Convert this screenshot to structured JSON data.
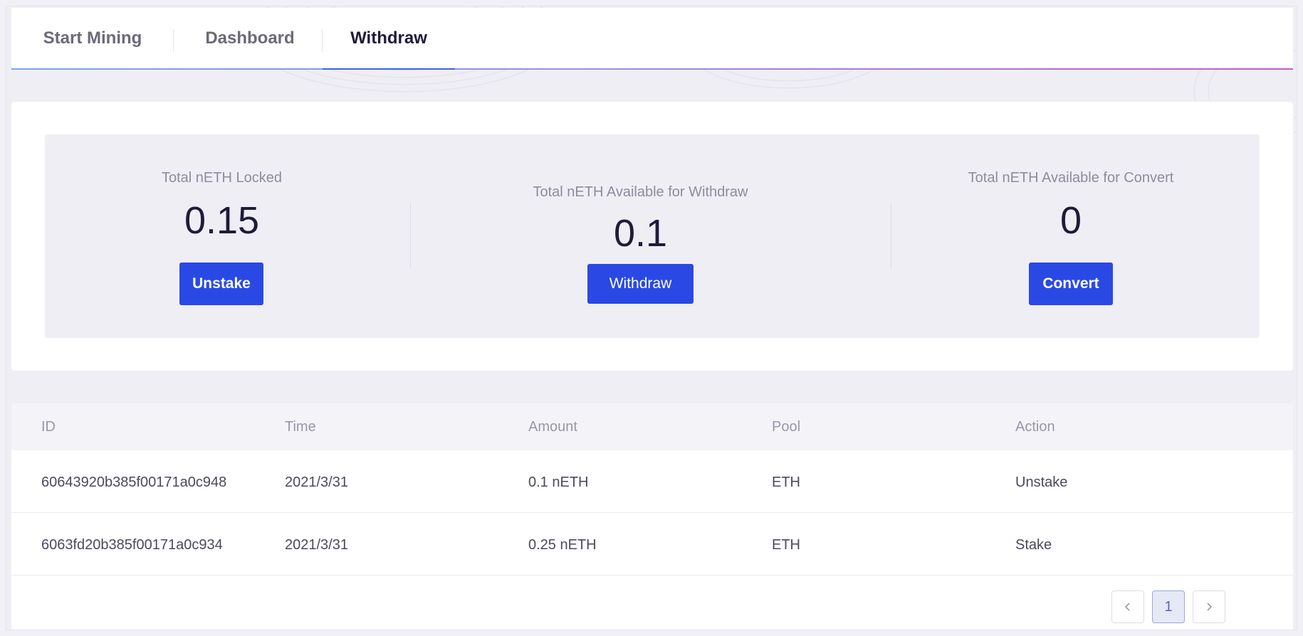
{
  "tabs": [
    {
      "label": "Start Mining"
    },
    {
      "label": "Dashboard"
    },
    {
      "label": "Withdraw"
    }
  ],
  "active_tab": "Withdraw",
  "summary": {
    "locked": {
      "label": "Total nETH Locked",
      "value": "0.15",
      "button": "Unstake"
    },
    "withdraw": {
      "label": "Total nETH Available for Withdraw",
      "value": "0.1",
      "button": "Withdraw"
    },
    "convert": {
      "label": "Total nETH Available for Convert",
      "value": "0",
      "button": "Convert"
    }
  },
  "table": {
    "headers": [
      "ID",
      "Time",
      "Amount",
      "Pool",
      "Action"
    ],
    "rows": [
      [
        "60643920b385f00171a0c948",
        "2021/3/31",
        "0.1 nETH",
        "ETH",
        "Unstake"
      ],
      [
        "6063fd20b385f00171a0c934",
        "2021/3/31",
        "0.25 nETH",
        "ETH",
        "Stake"
      ]
    ]
  },
  "pagination": {
    "prev_icon": "chevron-left-icon",
    "current_page": "1",
    "next_icon": "chevron-right-icon"
  },
  "colors": {
    "primary_button": "#2a49e4",
    "active_tab_underline": "#3b62e0",
    "page_background": "#efeef4"
  }
}
